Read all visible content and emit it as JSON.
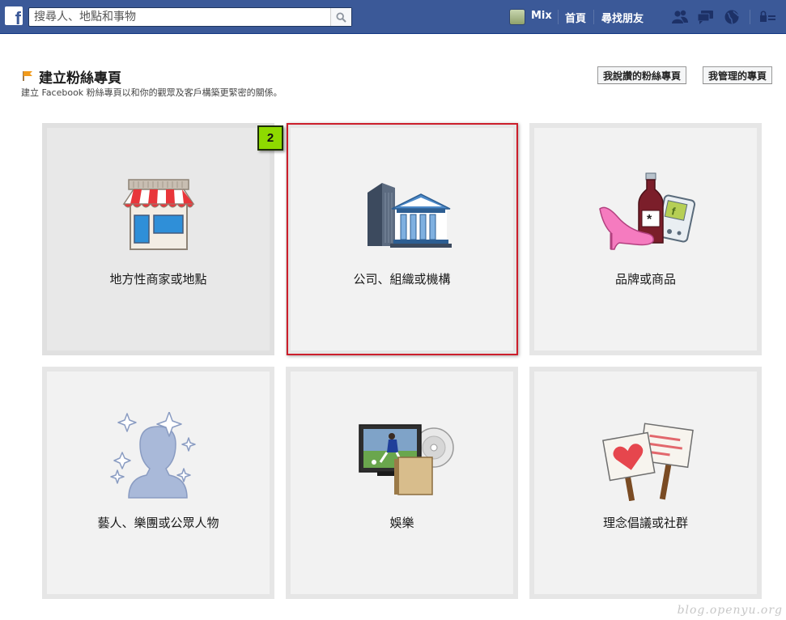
{
  "topbar": {
    "search_placeholder": "搜尋人、地點和事物",
    "user_name": "Mix",
    "home_label": "首頁",
    "find_friends_label": "尋找朋友",
    "bar_color": "#3b5998"
  },
  "header": {
    "title": "建立粉絲專頁",
    "subtitle": "建立 Facebook 粉絲專頁以和你的觀眾及客戶構築更緊密的關係。",
    "liked_pages_button": "我說讚的粉絲專頁",
    "managed_pages_button": "我管理的專頁"
  },
  "tiles": [
    {
      "label": "地方性商家或地點",
      "icon": "storefront-icon"
    },
    {
      "label": "公司、組織或機構",
      "icon": "company-building-icon"
    },
    {
      "label": "品牌或商品",
      "icon": "brand-products-icon"
    },
    {
      "label": "藝人、樂團或公眾人物",
      "icon": "public-figure-icon"
    },
    {
      "label": "娛樂",
      "icon": "entertainment-icon"
    },
    {
      "label": "理念倡議或社群",
      "icon": "cause-community-icon"
    }
  ],
  "annotation": {
    "step_number": "2",
    "highlight_color": "#cc1e2b",
    "badge_color": "#8ed900"
  },
  "watermark": "blog.openyu.org"
}
